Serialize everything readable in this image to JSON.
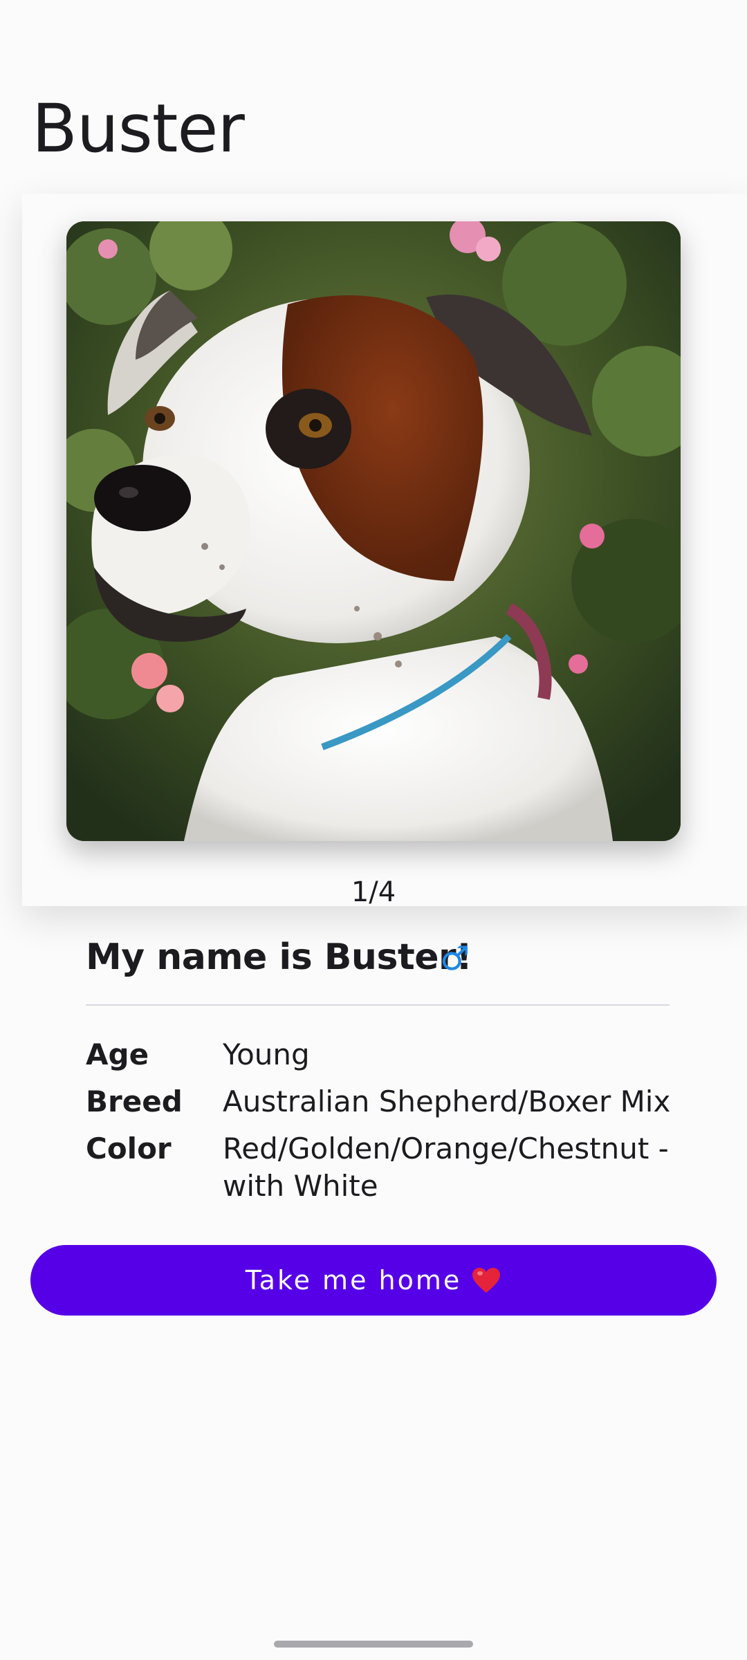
{
  "header": {
    "title": "Buster"
  },
  "carousel": {
    "photo_alt": "Buster",
    "indicator": "1/4"
  },
  "profile": {
    "heading": "My name is Buster!",
    "gender_symbol": "♂",
    "details": [
      {
        "label": "Age",
        "value": "Young"
      },
      {
        "label": "Breed",
        "value": "Australian Shepherd/Boxer Mix"
      },
      {
        "label": "Color",
        "value": "Red/Golden/Orange/Chestnut - with White"
      }
    ]
  },
  "actions": {
    "adopt_label": "Take me home"
  },
  "colors": {
    "accent": "#5600e8",
    "gender_icon": "#1e88e5",
    "background": "#fcfbfc"
  },
  "icons": {
    "gender": "male-gender-icon",
    "button": "heart-icon"
  }
}
